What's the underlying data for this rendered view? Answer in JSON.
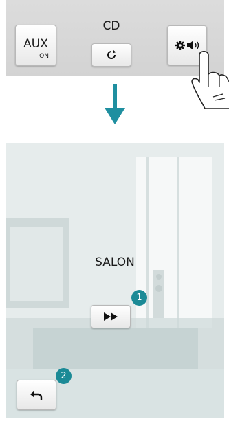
{
  "top_panel": {
    "aux": {
      "label": "AUX",
      "status": "ON"
    },
    "cd": {
      "label": "CD"
    },
    "settings_volume_icons": [
      "gear-icon",
      "speaker-icon"
    ]
  },
  "bottom_panel": {
    "room_name": "SALON",
    "forward_icon": "fast-forward-icon",
    "back_icon": "back-arrow-icon",
    "callouts": [
      "1",
      "2"
    ]
  },
  "colors": {
    "accent": "#1b8a96",
    "arrow": "#1f8fa0",
    "panel_grey": "#d8d8d8"
  }
}
